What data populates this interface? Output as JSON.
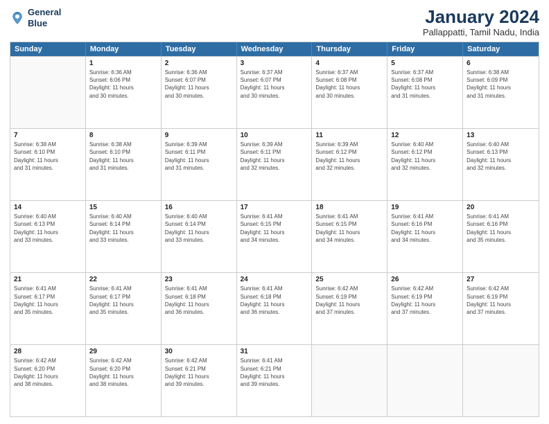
{
  "logo": {
    "line1": "General",
    "line2": "Blue"
  },
  "title": "January 2024",
  "location": "Pallappatti, Tamil Nadu, India",
  "header_days": [
    "Sunday",
    "Monday",
    "Tuesday",
    "Wednesday",
    "Thursday",
    "Friday",
    "Saturday"
  ],
  "rows": [
    [
      {
        "day": "",
        "info": ""
      },
      {
        "day": "1",
        "info": "Sunrise: 6:36 AM\nSunset: 6:06 PM\nDaylight: 11 hours\nand 30 minutes."
      },
      {
        "day": "2",
        "info": "Sunrise: 6:36 AM\nSunset: 6:07 PM\nDaylight: 11 hours\nand 30 minutes."
      },
      {
        "day": "3",
        "info": "Sunrise: 6:37 AM\nSunset: 6:07 PM\nDaylight: 11 hours\nand 30 minutes."
      },
      {
        "day": "4",
        "info": "Sunrise: 6:37 AM\nSunset: 6:08 PM\nDaylight: 11 hours\nand 30 minutes."
      },
      {
        "day": "5",
        "info": "Sunrise: 6:37 AM\nSunset: 6:08 PM\nDaylight: 11 hours\nand 31 minutes."
      },
      {
        "day": "6",
        "info": "Sunrise: 6:38 AM\nSunset: 6:09 PM\nDaylight: 11 hours\nand 31 minutes."
      }
    ],
    [
      {
        "day": "7",
        "info": "Sunrise: 6:38 AM\nSunset: 6:10 PM\nDaylight: 11 hours\nand 31 minutes."
      },
      {
        "day": "8",
        "info": "Sunrise: 6:38 AM\nSunset: 6:10 PM\nDaylight: 11 hours\nand 31 minutes."
      },
      {
        "day": "9",
        "info": "Sunrise: 6:39 AM\nSunset: 6:11 PM\nDaylight: 11 hours\nand 31 minutes."
      },
      {
        "day": "10",
        "info": "Sunrise: 6:39 AM\nSunset: 6:11 PM\nDaylight: 11 hours\nand 32 minutes."
      },
      {
        "day": "11",
        "info": "Sunrise: 6:39 AM\nSunset: 6:12 PM\nDaylight: 11 hours\nand 32 minutes."
      },
      {
        "day": "12",
        "info": "Sunrise: 6:40 AM\nSunset: 6:12 PM\nDaylight: 11 hours\nand 32 minutes."
      },
      {
        "day": "13",
        "info": "Sunrise: 6:40 AM\nSunset: 6:13 PM\nDaylight: 11 hours\nand 32 minutes."
      }
    ],
    [
      {
        "day": "14",
        "info": "Sunrise: 6:40 AM\nSunset: 6:13 PM\nDaylight: 11 hours\nand 33 minutes."
      },
      {
        "day": "15",
        "info": "Sunrise: 6:40 AM\nSunset: 6:14 PM\nDaylight: 11 hours\nand 33 minutes."
      },
      {
        "day": "16",
        "info": "Sunrise: 6:40 AM\nSunset: 6:14 PM\nDaylight: 11 hours\nand 33 minutes."
      },
      {
        "day": "17",
        "info": "Sunrise: 6:41 AM\nSunset: 6:15 PM\nDaylight: 11 hours\nand 34 minutes."
      },
      {
        "day": "18",
        "info": "Sunrise: 6:41 AM\nSunset: 6:15 PM\nDaylight: 11 hours\nand 34 minutes."
      },
      {
        "day": "19",
        "info": "Sunrise: 6:41 AM\nSunset: 6:16 PM\nDaylight: 11 hours\nand 34 minutes."
      },
      {
        "day": "20",
        "info": "Sunrise: 6:41 AM\nSunset: 6:16 PM\nDaylight: 11 hours\nand 35 minutes."
      }
    ],
    [
      {
        "day": "21",
        "info": "Sunrise: 6:41 AM\nSunset: 6:17 PM\nDaylight: 11 hours\nand 35 minutes."
      },
      {
        "day": "22",
        "info": "Sunrise: 6:41 AM\nSunset: 6:17 PM\nDaylight: 11 hours\nand 35 minutes."
      },
      {
        "day": "23",
        "info": "Sunrise: 6:41 AM\nSunset: 6:18 PM\nDaylight: 11 hours\nand 36 minutes."
      },
      {
        "day": "24",
        "info": "Sunrise: 6:41 AM\nSunset: 6:18 PM\nDaylight: 11 hours\nand 36 minutes."
      },
      {
        "day": "25",
        "info": "Sunrise: 6:42 AM\nSunset: 6:19 PM\nDaylight: 11 hours\nand 37 minutes."
      },
      {
        "day": "26",
        "info": "Sunrise: 6:42 AM\nSunset: 6:19 PM\nDaylight: 11 hours\nand 37 minutes."
      },
      {
        "day": "27",
        "info": "Sunrise: 6:42 AM\nSunset: 6:19 PM\nDaylight: 11 hours\nand 37 minutes."
      }
    ],
    [
      {
        "day": "28",
        "info": "Sunrise: 6:42 AM\nSunset: 6:20 PM\nDaylight: 11 hours\nand 38 minutes."
      },
      {
        "day": "29",
        "info": "Sunrise: 6:42 AM\nSunset: 6:20 PM\nDaylight: 11 hours\nand 38 minutes."
      },
      {
        "day": "30",
        "info": "Sunrise: 6:42 AM\nSunset: 6:21 PM\nDaylight: 11 hours\nand 39 minutes."
      },
      {
        "day": "31",
        "info": "Sunrise: 6:41 AM\nSunset: 6:21 PM\nDaylight: 11 hours\nand 39 minutes."
      },
      {
        "day": "",
        "info": ""
      },
      {
        "day": "",
        "info": ""
      },
      {
        "day": "",
        "info": ""
      }
    ]
  ]
}
